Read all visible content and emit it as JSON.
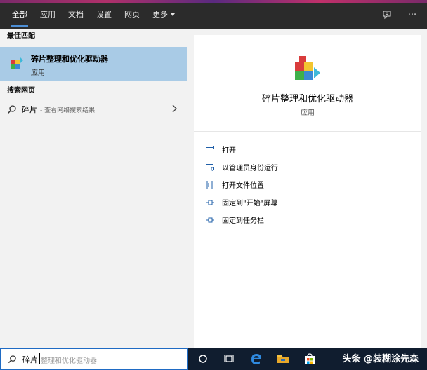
{
  "tabs": [
    {
      "label": "全部",
      "active": true
    },
    {
      "label": "应用"
    },
    {
      "label": "文档"
    },
    {
      "label": "设置"
    },
    {
      "label": "网页"
    },
    {
      "label": "更多"
    }
  ],
  "header_icons": {
    "feedback": "feedback-icon",
    "more": "···"
  },
  "best_match": {
    "section_title": "最佳匹配",
    "name": "碎片整理和优化驱动器",
    "type": "应用"
  },
  "web_search": {
    "section_title": "搜索网页",
    "query": "碎片",
    "hint": "- 查看网络搜索结果"
  },
  "detail": {
    "name": "碎片整理和优化驱动器",
    "type": "应用",
    "actions": [
      {
        "label": "打开",
        "icon": "open-icon"
      },
      {
        "label": "以管理员身份运行",
        "icon": "shield-icon"
      },
      {
        "label": "打开文件位置",
        "icon": "file-location-icon"
      },
      {
        "label": "固定到\"开始\"屏幕",
        "icon": "pin-icon"
      },
      {
        "label": "固定到任务栏",
        "icon": "pin-icon"
      }
    ]
  },
  "search_box": {
    "typed": "碎片",
    "suggestion": "整理和优化驱动器"
  },
  "watermark": "头条 @装糊涂先森",
  "colors": {
    "accent": "#4d8fd6",
    "selected": "#a9cbe6",
    "taskbar": "#101d2f",
    "search_border": "#1f6bc4"
  }
}
